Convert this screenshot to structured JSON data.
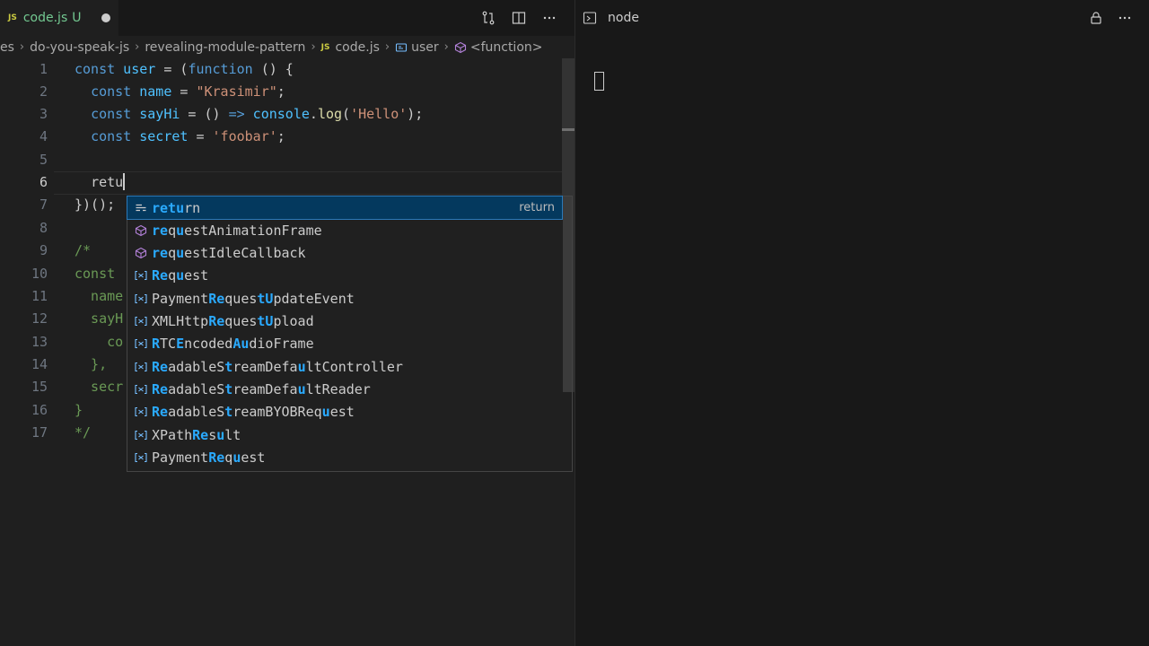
{
  "tab": {
    "badge": "JS",
    "name": "code.js",
    "status": "U"
  },
  "breadcrumb": {
    "items": [
      "es",
      "do-you-speak-js",
      "revealing-module-pattern"
    ],
    "file_badge": "JS",
    "file": "code.js",
    "symbol": "user",
    "function": "<function>"
  },
  "gutter": [
    "1",
    "2",
    "3",
    "4",
    "5",
    "6",
    "7",
    "8",
    "9",
    "10",
    "11",
    "12",
    "13",
    "14",
    "15",
    "16",
    "17"
  ],
  "code": {
    "l1": {
      "kw1": "const",
      "var": " user",
      "p1": " = (",
      "kw2": "function",
      "p2": " () {"
    },
    "l2": {
      "ind": "  ",
      "kw": "const",
      "var": " name",
      "p1": " = ",
      "str": "\"Krasimir\"",
      "p2": ";"
    },
    "l3": {
      "ind": "  ",
      "kw": "const",
      "fn1": " sayHi",
      "p1": " = () ",
      "kw2": "=>",
      "var": " console",
      "p2": ".",
      "fn2": "log",
      "p3": "(",
      "str": "'Hello'",
      "p4": ");"
    },
    "l4": {
      "ind": "  ",
      "kw": "const",
      "var": " secret",
      "p1": " = ",
      "str": "'foobar'",
      "p2": ";"
    },
    "l6": {
      "ind": "  ",
      "text": "retu"
    },
    "l7": {
      "text": "})();"
    },
    "l9": {
      "text": "/*"
    },
    "l10": {
      "text": "const"
    },
    "l11": {
      "text": "  name"
    },
    "l12": {
      "text": "  sayH"
    },
    "l13": {
      "text": "    co"
    },
    "l14": {
      "text": "  },"
    },
    "l15": {
      "text": "  secr"
    },
    "l16": {
      "text": "}"
    },
    "l17": {
      "text": "*/"
    }
  },
  "suggestions": [
    {
      "icon": "keyword-icon",
      "parts": [
        [
          "hl",
          "retu"
        ],
        [
          "n",
          "rn"
        ]
      ],
      "detail": "return",
      "selected": true
    },
    {
      "icon": "method-icon",
      "parts": [
        [
          "hl",
          "re"
        ],
        [
          "n",
          "q"
        ],
        [
          "hl",
          "u"
        ],
        [
          "n",
          "estAnimationFrame"
        ]
      ]
    },
    {
      "icon": "method-icon",
      "parts": [
        [
          "hl",
          "re"
        ],
        [
          "n",
          "q"
        ],
        [
          "hl",
          "u"
        ],
        [
          "n",
          "estIdleCallback"
        ]
      ]
    },
    {
      "icon": "variable-icon",
      "parts": [
        [
          "hl",
          "Re"
        ],
        [
          "n",
          "q"
        ],
        [
          "hl",
          "u"
        ],
        [
          "n",
          "est"
        ]
      ]
    },
    {
      "icon": "variable-icon",
      "parts": [
        [
          "n",
          "Payment"
        ],
        [
          "hl",
          "Re"
        ],
        [
          "n",
          "ques"
        ],
        [
          "hl",
          "tU"
        ],
        [
          "n",
          "pdateEvent"
        ]
      ]
    },
    {
      "icon": "variable-icon",
      "parts": [
        [
          "n",
          "XMLHttp"
        ],
        [
          "hl",
          "Re"
        ],
        [
          "n",
          "ques"
        ],
        [
          "hl",
          "tU"
        ],
        [
          "n",
          "pload"
        ]
      ]
    },
    {
      "icon": "variable-icon",
      "parts": [
        [
          "hl",
          "R"
        ],
        [
          "n",
          "TC"
        ],
        [
          "hl",
          "E"
        ],
        [
          "n",
          "ncoded"
        ],
        [
          "hl",
          "Au"
        ],
        [
          "n",
          "dioFrame"
        ]
      ]
    },
    {
      "icon": "variable-icon",
      "parts": [
        [
          "hl",
          "Re"
        ],
        [
          "n",
          "adableS"
        ],
        [
          "hl",
          "t"
        ],
        [
          "n",
          "reamDefa"
        ],
        [
          "hl",
          "u"
        ],
        [
          "n",
          "ltController"
        ]
      ]
    },
    {
      "icon": "variable-icon",
      "parts": [
        [
          "hl",
          "Re"
        ],
        [
          "n",
          "adableS"
        ],
        [
          "hl",
          "t"
        ],
        [
          "n",
          "reamDefa"
        ],
        [
          "hl",
          "u"
        ],
        [
          "n",
          "ltReader"
        ]
      ]
    },
    {
      "icon": "variable-icon",
      "parts": [
        [
          "hl",
          "Re"
        ],
        [
          "n",
          "adableS"
        ],
        [
          "hl",
          "t"
        ],
        [
          "n",
          "reamBYOBReq"
        ],
        [
          "hl",
          "u"
        ],
        [
          "n",
          "est"
        ]
      ]
    },
    {
      "icon": "variable-icon",
      "parts": [
        [
          "n",
          "XPath"
        ],
        [
          "hl",
          "Re"
        ],
        [
          "n",
          "s"
        ],
        [
          "hl",
          "u"
        ],
        [
          "n",
          "lt"
        ]
      ]
    },
    {
      "icon": "variable-icon",
      "parts": [
        [
          "n",
          "Payment"
        ],
        [
          "hl",
          "Re"
        ],
        [
          "n",
          "q"
        ],
        [
          "hl",
          "u"
        ],
        [
          "n",
          "est"
        ]
      ]
    }
  ],
  "panel": {
    "title": "node"
  },
  "colors": {
    "accent_blue": "#2aaaff",
    "git_untracked": "#73c991",
    "js_badge": "#cbcb41",
    "selected_bg": "#04395e"
  }
}
